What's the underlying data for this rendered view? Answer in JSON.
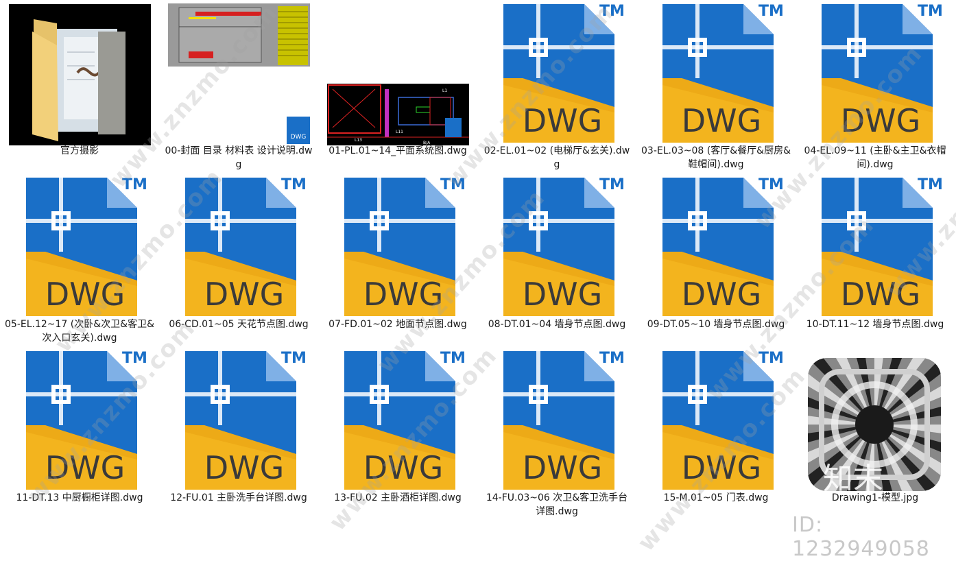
{
  "files": [
    {
      "kind": "folder",
      "label": "官方摄影"
    },
    {
      "kind": "preview-cover",
      "label": "00-封面 目录 材料表 设计说明.dwg",
      "badge": "DWG"
    },
    {
      "kind": "preview-plan",
      "label": "01-PL.01~14_平面系统图.dwg"
    },
    {
      "kind": "dwg",
      "label": "02-EL.01~02 (电梯厅&玄关).dwg"
    },
    {
      "kind": "dwg",
      "label": "03-EL.03~08 (客厅&餐厅&厨房&鞋帽间).dwg"
    },
    {
      "kind": "dwg",
      "label": "04-EL.09~11 (主卧&主卫&衣帽间).dwg"
    },
    {
      "kind": "dwg",
      "label": "05-EL.12~17 (次卧&次卫&客卫&次入口玄关).dwg"
    },
    {
      "kind": "dwg",
      "label": "06-CD.01~05 天花节点图.dwg"
    },
    {
      "kind": "dwg",
      "label": "07-FD.01~02 地面节点图.dwg"
    },
    {
      "kind": "dwg",
      "label": "08-DT.01~04 墙身节点图.dwg"
    },
    {
      "kind": "dwg",
      "label": "09-DT.05~10 墙身节点图.dwg"
    },
    {
      "kind": "dwg",
      "label": "10-DT.11~12 墙身节点图.dwg"
    },
    {
      "kind": "dwg",
      "label": "11-DT.13 中厨橱柜详图.dwg"
    },
    {
      "kind": "dwg",
      "label": "12-FU.01 主卧洗手台详图.dwg"
    },
    {
      "kind": "dwg",
      "label": "13-FU.02 主卧酒柜详图.dwg"
    },
    {
      "kind": "dwg",
      "label": "14-FU.03~06 次卫&客卫洗手台详图.dwg"
    },
    {
      "kind": "dwg",
      "label": "15-M.01~05 门表.dwg"
    },
    {
      "kind": "jpg",
      "label": "Drawing1-模型.jpg"
    }
  ],
  "dwg_icon": {
    "text": "DWG",
    "tm": "TM",
    "blue": "#1a6fc7",
    "yellow": "#f3b41e"
  },
  "plan_labels": {
    "a": "L1",
    "b": "L11",
    "c": "L13",
    "d": "B/A"
  },
  "jpg_overlay": "知末",
  "watermark": "www.znzmo.com",
  "id_text": "ID: 1232949058"
}
